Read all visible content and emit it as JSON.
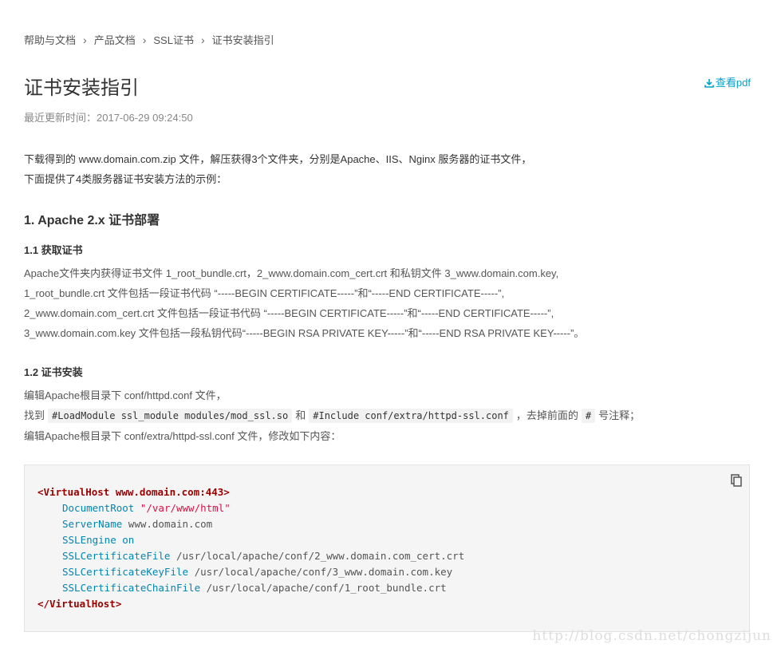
{
  "breadcrumb": {
    "items": [
      "帮助与文档",
      "产品文档",
      "SSL证书",
      "证书安装指引"
    ],
    "separator": "›"
  },
  "page": {
    "title": "证书安装指引",
    "pdf_link": "查看pdf",
    "updated": "最近更新时间：2017-06-29 09:24:50"
  },
  "intro": {
    "line1": "下载得到的 www.domain.com.zip 文件，解压获得3个文件夹，分别是Apache、IIS、Nginx 服务器的证书文件，",
    "line2": "下面提供了4类服务器证书安装方法的示例："
  },
  "section1": {
    "heading": "1. Apache 2.x 证书部署",
    "sub1": {
      "heading": "1.1 获取证书",
      "lines": [
        "Apache文件夹内获得证书文件 1_root_bundle.crt，2_www.domain.com_cert.crt 和私钥文件 3_www.domain.com.key,",
        "1_root_bundle.crt 文件包括一段证书代码 “-----BEGIN CERTIFICATE-----”和“-----END CERTIFICATE-----”,",
        "2_www.domain.com_cert.crt 文件包括一段证书代码 “-----BEGIN CERTIFICATE-----”和“-----END CERTIFICATE-----”,",
        "3_www.domain.com.key 文件包括一段私钥代码“-----BEGIN RSA PRIVATE KEY-----”和“-----END RSA PRIVATE KEY-----”。"
      ]
    },
    "sub2": {
      "heading": "1.2 证书安装",
      "line1": "编辑Apache根目录下 conf/httpd.conf 文件，",
      "line2_prefix": "找到",
      "line2_code1": "#LoadModule ssl_module modules/mod_ssl.so",
      "line2_and": "和",
      "line2_code2": "#Include conf/extra/httpd-ssl.conf",
      "line2_mid": "，去掉前面的",
      "line2_code3": "#",
      "line2_suffix": "号注释；",
      "line3": "编辑Apache根目录下 conf/extra/httpd-ssl.conf 文件，修改如下内容："
    }
  },
  "code": {
    "open_tag": "<VirtualHost www.domain.com:443>",
    "lines": [
      {
        "key": "DocumentRoot",
        "value": "\"/var/www/html\"",
        "kind": "str"
      },
      {
        "key": "ServerName",
        "value": "www.domain.com",
        "kind": "plain"
      },
      {
        "key": "SSLEngine",
        "value": "on",
        "kind": "kw"
      },
      {
        "key": "SSLCertificateFile",
        "value": "/usr/local/apache/conf/2_www.domain.com_cert.crt",
        "kind": "plain"
      },
      {
        "key": "SSLCertificateKeyFile",
        "value": "/usr/local/apache/conf/3_www.domain.com.key",
        "kind": "plain"
      },
      {
        "key": "SSLCertificateChainFile",
        "value": "/usr/local/apache/conf/1_root_bundle.crt",
        "kind": "plain"
      }
    ],
    "close_tag": "</VirtualHost>"
  },
  "watermark": "http://blog.csdn.net/chongzijun",
  "colors": {
    "link": "#00a2ca",
    "tag": "#990000",
    "keyword": "#0086b3",
    "string": "#dd1144"
  },
  "icons": {
    "pdf": "download-icon",
    "copy": "copy-icon"
  }
}
